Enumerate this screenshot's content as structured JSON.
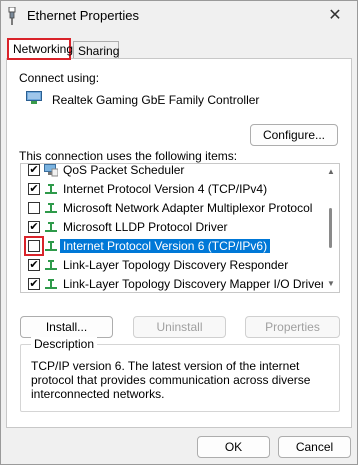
{
  "window": {
    "title": "Ethernet Properties",
    "close": "✕"
  },
  "tabs": [
    {
      "label": "Networking"
    },
    {
      "label": "Sharing"
    }
  ],
  "connect_using": {
    "label": "Connect using:",
    "adapter": "Realtek Gaming GbE Family Controller"
  },
  "buttons": {
    "configure": "Configure...",
    "install": "Install...",
    "uninstall": "Uninstall",
    "properties": "Properties",
    "ok": "OK",
    "cancel": "Cancel"
  },
  "items_label": "This connection uses the following items:",
  "items": [
    {
      "label": "QoS Packet Scheduler",
      "checked": true,
      "icon": "qos-scheduler-icon"
    },
    {
      "label": "Internet Protocol Version 4 (TCP/IPv4)",
      "checked": true,
      "icon": "protocol-icon"
    },
    {
      "label": "Microsoft Network Adapter Multiplexor Protocol",
      "checked": false,
      "icon": "protocol-icon"
    },
    {
      "label": "Microsoft LLDP Protocol Driver",
      "checked": true,
      "icon": "protocol-icon"
    },
    {
      "label": "Internet Protocol Version 6 (TCP/IPv6)",
      "checked": false,
      "icon": "protocol-icon",
      "selected": true
    },
    {
      "label": "Link-Layer Topology Discovery Responder",
      "checked": true,
      "icon": "protocol-icon"
    },
    {
      "label": "Link-Layer Topology Discovery Mapper I/O Driver",
      "checked": true,
      "icon": "protocol-icon"
    }
  ],
  "description": {
    "title": "Description",
    "text": "TCP/IP version 6. The latest version of the internet protocol that provides communication across diverse interconnected networks."
  },
  "colors": {
    "selection": "#0078d7",
    "annotation": "#d9232a",
    "protocol_icon": "#2e9a4a"
  }
}
